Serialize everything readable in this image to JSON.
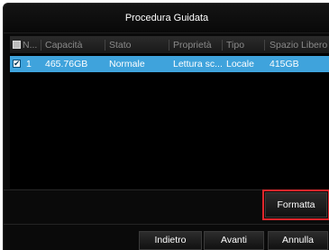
{
  "window": {
    "title": "Procedura Guidata"
  },
  "table": {
    "columns": {
      "number": "N...",
      "capacity": "Capacità",
      "status": "Stato",
      "property": "Proprietà",
      "type": "Tipo",
      "free_space": "Spazio Libero"
    },
    "rows": [
      {
        "checked": true,
        "check_glyph": "✔",
        "number": "1",
        "capacity": "465.76GB",
        "status": "Normale",
        "property": "Lettura sc...",
        "type": "Locale",
        "free_space": "415GB"
      }
    ]
  },
  "buttons": {
    "format": "Formatta",
    "back": "Indietro",
    "next": "Avanti",
    "cancel": "Annulla"
  },
  "colors": {
    "selected_row": "#3fa3dc",
    "highlight_box": "#e0262b",
    "background": "#0a0a0a"
  }
}
